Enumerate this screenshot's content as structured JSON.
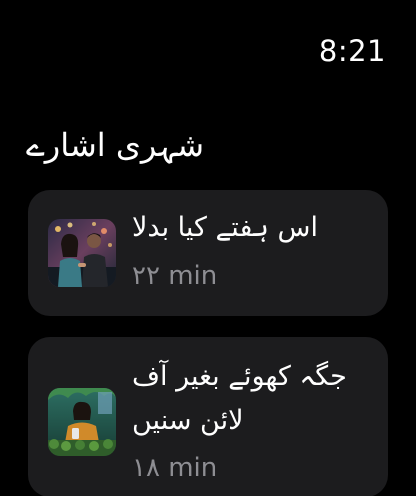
{
  "status_bar": {
    "time": "8:21"
  },
  "section": {
    "title": "شہری اشارے"
  },
  "cards": [
    {
      "title": "اس ہفتے کیا بدلا",
      "duration": "۲۲ min",
      "thumbnail_icon": "couple-photo-thumbnail"
    },
    {
      "title": "جگہ کھوئے بغیر آف لائن سنیں",
      "duration": "۱۸ min",
      "thumbnail_icon": "woman-with-phone-thumbnail"
    }
  ],
  "colors": {
    "background": "#000000",
    "card_background": "#1c1c1e",
    "primary_text": "#ffffff",
    "secondary_text": "#8e8e93"
  }
}
